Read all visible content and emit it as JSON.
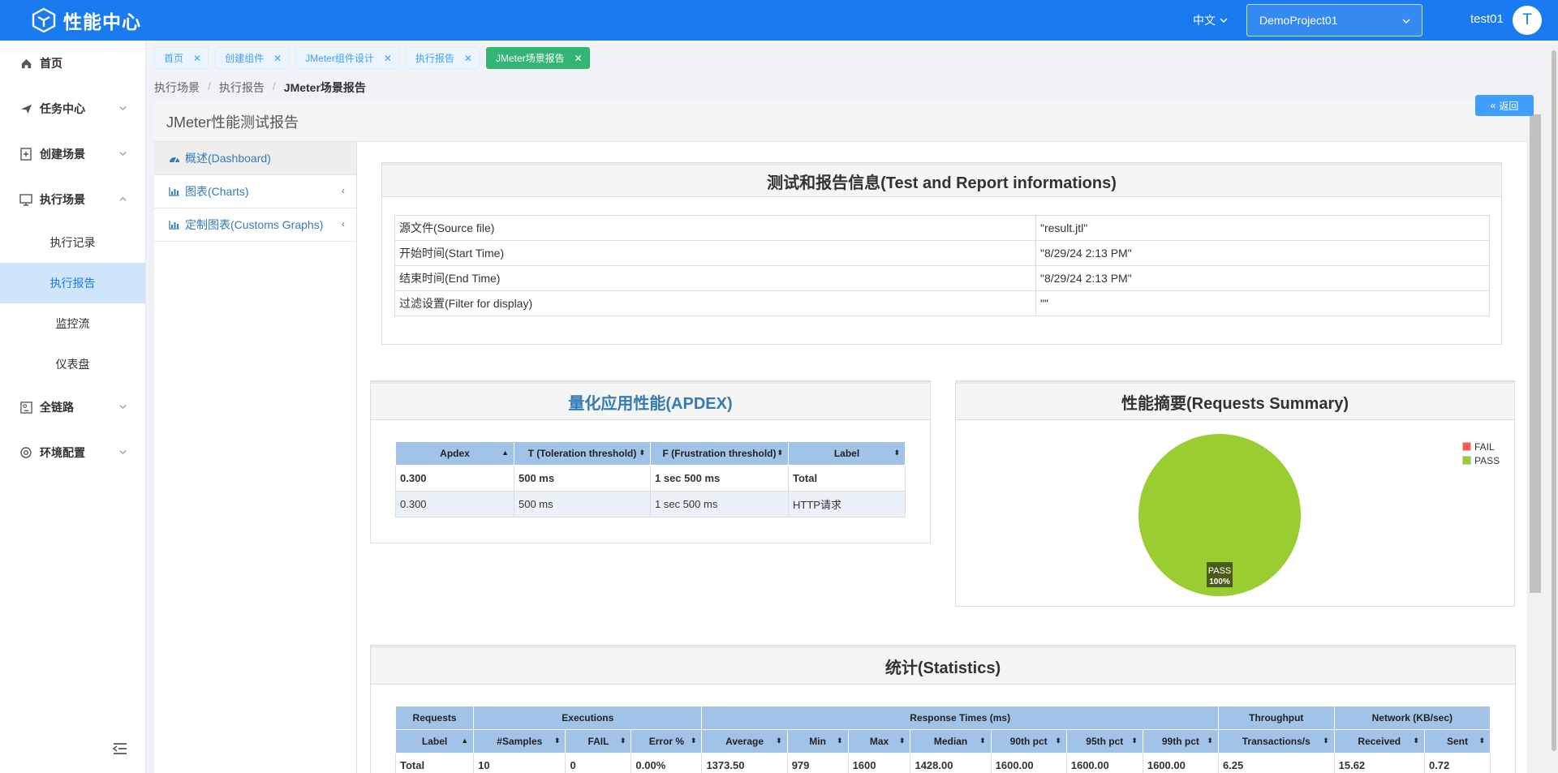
{
  "header": {
    "logo_text": "性能中心",
    "language": "中文",
    "project": "DemoProject01",
    "username": "test01",
    "avatar_letter": "T"
  },
  "sidebar": {
    "items": [
      {
        "label": "首页",
        "icon": "home-icon"
      },
      {
        "label": "任务中心",
        "icon": "send-icon"
      },
      {
        "label": "创建场景",
        "icon": "document-add-icon"
      },
      {
        "label": "执行场景",
        "icon": "monitor-icon"
      },
      {
        "label": "全链路",
        "icon": "link-icon"
      },
      {
        "label": "环境配置",
        "icon": "settings-icon"
      }
    ],
    "sub_items": [
      "执行记录",
      "执行报告",
      "监控流",
      "仪表盘"
    ],
    "active_sub": "执行报告"
  },
  "tabs": [
    {
      "label": "首页"
    },
    {
      "label": "创建组件"
    },
    {
      "label": "JMeter组件设计"
    },
    {
      "label": "执行报告"
    },
    {
      "label": "JMeter场景报告",
      "active": true
    }
  ],
  "breadcrumb": [
    "执行场景",
    "执行报告",
    "JMeter场景报告"
  ],
  "back_button": "返回",
  "report": {
    "title": "JMeter性能测试报告",
    "nav": [
      {
        "label": "概述(Dashboard)"
      },
      {
        "label": "图表(Charts)"
      },
      {
        "label": "定制图表(Customs Graphs)"
      }
    ],
    "info_panel": {
      "title": "测试和报告信息(Test and Report informations)",
      "rows": [
        {
          "key": "源文件(Source file)",
          "value": "\"result.jtl\""
        },
        {
          "key": "开始时间(Start Time)",
          "value": "\"8/29/24 2:13 PM\""
        },
        {
          "key": "结束时间(End Time)",
          "value": "\"8/29/24 2:13 PM\""
        },
        {
          "key": "过滤设置(Filter for display)",
          "value": "\"\""
        }
      ]
    },
    "apdex_panel": {
      "title": "量化应用性能(APDEX)",
      "columns": [
        "Apdex",
        "T (Toleration threshold)",
        "F (Frustration threshold)",
        "Label"
      ],
      "rows": [
        [
          "0.300",
          "500 ms",
          "1 sec 500 ms",
          "Total"
        ],
        [
          "0.300",
          "500 ms",
          "1 sec 500 ms",
          "HTTP请求"
        ]
      ]
    },
    "summary_panel": {
      "title": "性能摘要(Requests Summary)",
      "legend": [
        {
          "label": "FAIL",
          "color": "#ff5a4a"
        },
        {
          "label": "PASS",
          "color": "#9acd32"
        }
      ],
      "pie_label_name": "PASS",
      "pie_label_pct": "100%"
    },
    "stats_panel": {
      "title": "统计(Statistics)",
      "groups": [
        {
          "label": "Requests",
          "span": 1
        },
        {
          "label": "Executions",
          "span": 3
        },
        {
          "label": "Response Times (ms)",
          "span": 7
        },
        {
          "label": "Throughput",
          "span": 1
        },
        {
          "label": "Network (KB/sec)",
          "span": 2
        }
      ],
      "columns": [
        "Label",
        "#Samples",
        "FAIL",
        "Error %",
        "Average",
        "Min",
        "Max",
        "Median",
        "90th pct",
        "95th pct",
        "99th pct",
        "Transactions/s",
        "Received",
        "Sent"
      ],
      "rows": [
        [
          "Total",
          "10",
          "0",
          "0.00%",
          "1373.50",
          "979",
          "1600",
          "1428.00",
          "1600.00",
          "1600.00",
          "1600.00",
          "6.25",
          "15.62",
          "0.72"
        ]
      ]
    }
  },
  "chart_data": {
    "type": "pie",
    "title": "性能摘要(Requests Summary)",
    "categories": [
      "FAIL",
      "PASS"
    ],
    "values": [
      0,
      100
    ],
    "legend": "top-right"
  },
  "colors": {
    "header": "#1a7af0",
    "active_tab": "#33b575",
    "table_header": "#a1c3e8",
    "pass": "#9acd32",
    "fail": "#ff5a4a"
  }
}
